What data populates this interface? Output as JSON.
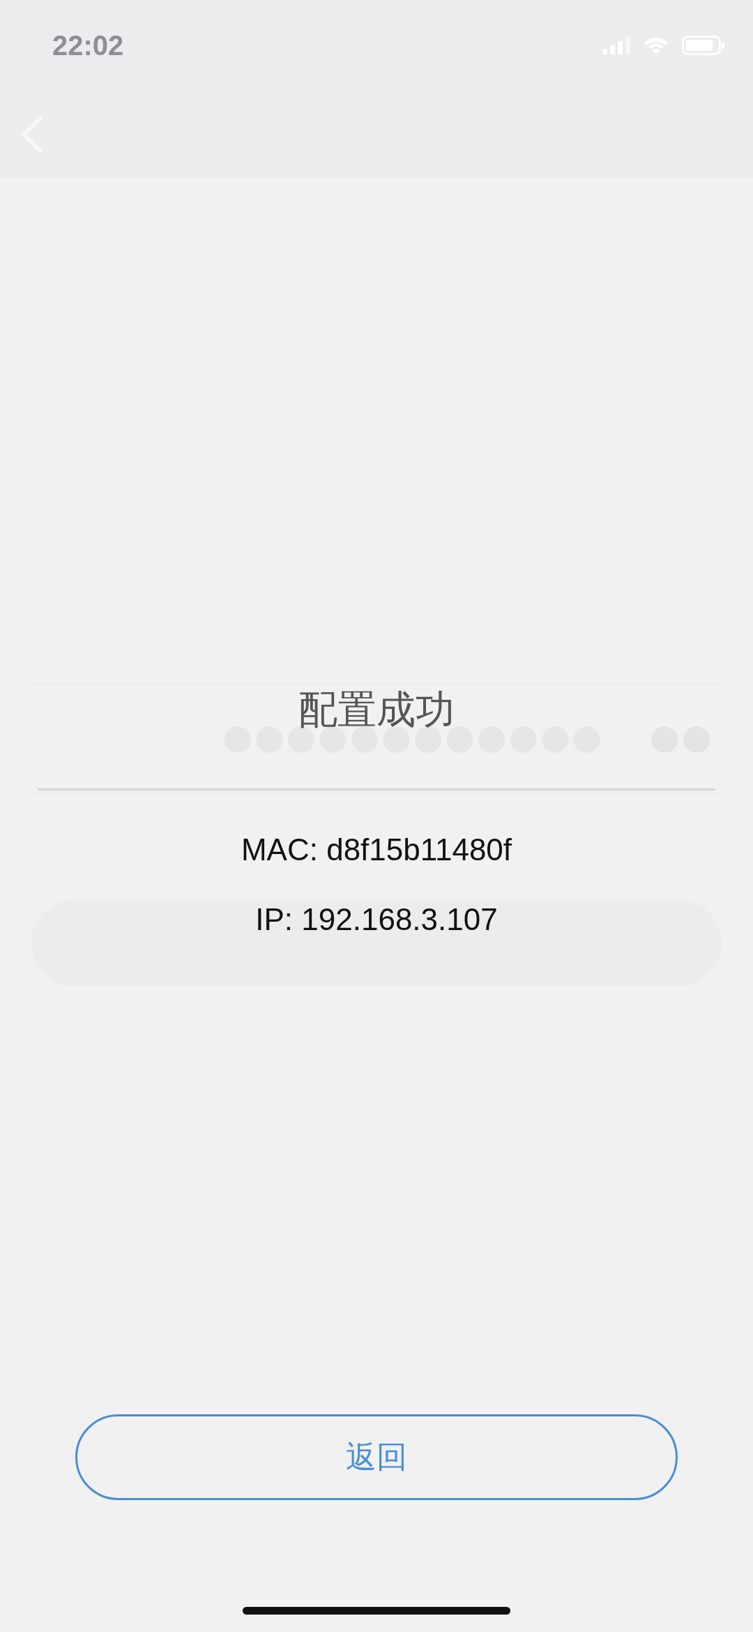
{
  "status_bar": {
    "time": "22:02"
  },
  "dialog": {
    "title": "配置成功",
    "lines": [
      "MAC: d8f15b11480f",
      "IP: 192.168.3.107"
    ]
  },
  "return_button": "返回"
}
